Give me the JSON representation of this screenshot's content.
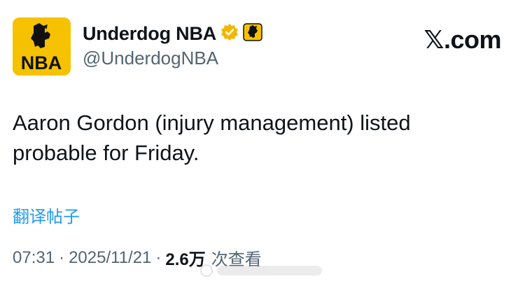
{
  "account": {
    "display_name": "Underdog NBA",
    "handle": "@UnderdogNBA",
    "avatar_text": "NBA",
    "verified_color": "#f2b600",
    "brand_color": "#f6c200"
  },
  "site": {
    "label": "𝕏.com"
  },
  "tweet": {
    "text_line1": "Aaron Gordon (injury management) listed",
    "text_line2": "probable for Friday.",
    "translate_label": "翻译帖子"
  },
  "meta": {
    "time": "07:31",
    "date": "2025/11/21",
    "separator": "·",
    "views_count": "2.6万",
    "views_label": "次查看"
  }
}
